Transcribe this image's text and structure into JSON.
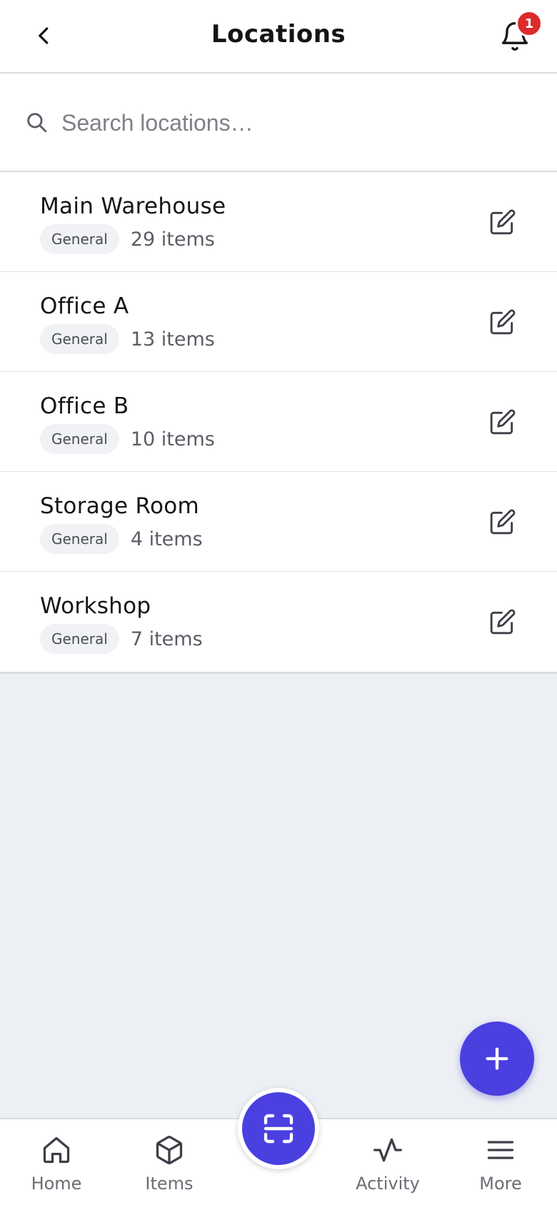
{
  "header": {
    "title": "Locations",
    "back_icon": "chevron-left-icon",
    "bell_icon": "bell-icon",
    "notification_count": "1"
  },
  "search": {
    "placeholder": "Search locations…",
    "value": ""
  },
  "locations": [
    {
      "name": "Main Warehouse",
      "tag": "General",
      "count": "29 items"
    },
    {
      "name": "Office A",
      "tag": "General",
      "count": "13 items"
    },
    {
      "name": "Office B",
      "tag": "General",
      "count": "10 items"
    },
    {
      "name": "Storage Room",
      "tag": "General",
      "count": "4 items"
    },
    {
      "name": "Workshop",
      "tag": "General",
      "count": "7 items"
    }
  ],
  "fab": {
    "icon": "plus-icon"
  },
  "bottom_nav": {
    "items": [
      {
        "label": "Home",
        "icon": "home-icon"
      },
      {
        "label": "Items",
        "icon": "box-icon"
      },
      {
        "label": "Activity",
        "icon": "activity-icon"
      },
      {
        "label": "More",
        "icon": "menu-icon"
      }
    ],
    "scan_icon": "scan-icon"
  },
  "colors": {
    "accent": "#4a40e0",
    "badge": "#dd2a2a",
    "background": "#eceff3"
  }
}
